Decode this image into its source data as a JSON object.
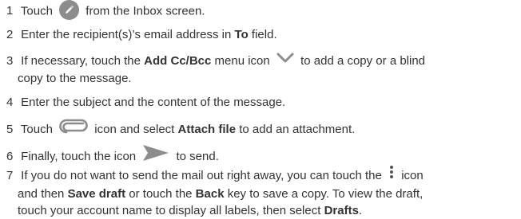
{
  "steps": [
    {
      "num": "1",
      "a": "Touch",
      "b": "from the Inbox screen.",
      "icon": "pencil-compose-icon"
    },
    {
      "num": "2",
      "a": "Enter the recipient(s)’s email address in",
      "bold1": "To",
      "b": "field."
    },
    {
      "num": "3",
      "a": "If necessary, touch the",
      "bold1": "Add Cc/Bcc",
      "b": "menu icon",
      "c": "to add a copy or a blind",
      "d": "copy to the message.",
      "icon": "chevron-down-icon"
    },
    {
      "num": "4",
      "a": "Enter the subject and the content of the message."
    },
    {
      "num": "5",
      "a": "Touch",
      "b": "icon and select",
      "bold1": "Attach file",
      "c": "to add an attachment.",
      "icon": "paperclip-icon"
    },
    {
      "num": "6",
      "a": "Finally, touch the icon",
      "b": "to send.",
      "icon": "send-arrow-icon"
    },
    {
      "num": "7",
      "a": "If you do not want to send the mail out right away, you can touch the",
      "b": "icon",
      "c": "and then",
      "bold1": "Save draft",
      "d": "or touch the",
      "bold2": "Back",
      "e": "key to save a copy. To view the draft,",
      "f": "touch your account name to display all labels, then select",
      "bold3": "Drafts",
      "g": ".",
      "icon": "more-vert-icon"
    }
  ],
  "colors": {
    "text": "#333333",
    "icon": "#8c8c8c"
  }
}
